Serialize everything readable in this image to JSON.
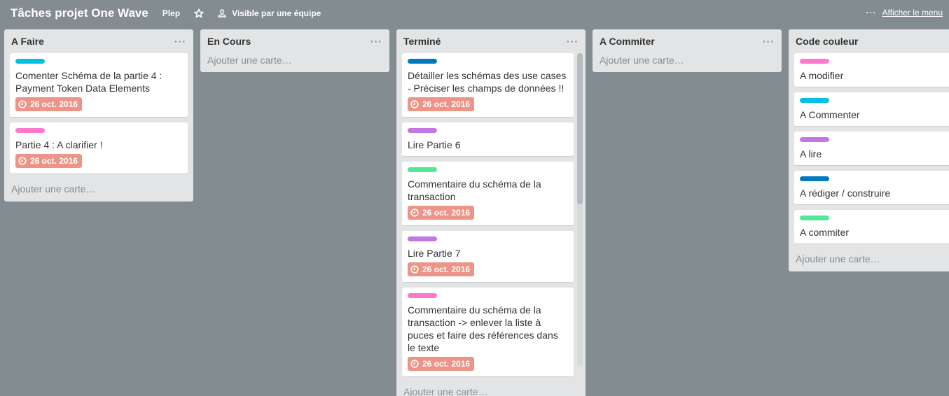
{
  "board": {
    "title": "Tâches projet One Wave",
    "org": "Plep",
    "visibility": "Visible par une équipe",
    "menu_label": "Afficher le menu"
  },
  "colors": {
    "cyan": "#00c2e0",
    "pink": "#ff78cb",
    "blue": "#0079bf",
    "purple": "#c377e0",
    "green": "#51e898",
    "due": "#ec9488"
  },
  "lists": {
    "afaire": {
      "title": "A Faire",
      "cards": [
        {
          "text": "Comenter Schéma de la partie 4 : Payment Token Data Elements",
          "label": "cyan",
          "due": "26 oct. 2016"
        },
        {
          "text": "Partie 4 : A clarifier !",
          "label": "pink",
          "due": "26 oct. 2016"
        }
      ],
      "add": "Ajouter une carte…"
    },
    "encours": {
      "title": "En Cours",
      "add": "Ajouter une carte…"
    },
    "termine": {
      "title": "Terminé",
      "cards": [
        {
          "text": "Détailler les schémas des use cases - Préciser les champs de données !!",
          "label": "blue",
          "due": "26 oct. 2016"
        },
        {
          "text": "Lire Partie 6",
          "label": "purple"
        },
        {
          "text": "Commentaire du schéma de la transaction",
          "label": "green",
          "due": "26 oct. 2016"
        },
        {
          "text": "Lire Partie 7",
          "label": "purple",
          "due": "26 oct. 2016"
        },
        {
          "text": "Commentaire du schéma de la transaction -> enlever la liste à puces et faire des références dans le texte",
          "label": "pink",
          "due": "26 oct. 2016"
        }
      ],
      "add": "Ajouter une carte…"
    },
    "acommiter": {
      "title": "A Commiter",
      "add": "Ajouter une carte…"
    },
    "codecouleur": {
      "title": "Code couleur",
      "cards": [
        {
          "text": "A modifier",
          "label": "pink"
        },
        {
          "text": "A Commenter",
          "label": "cyan"
        },
        {
          "text": "A lire",
          "label": "purple"
        },
        {
          "text": "A rédiger / construire",
          "label": "blue"
        },
        {
          "text": "A commiter",
          "label": "green"
        }
      ],
      "add": "Ajouter une carte…"
    }
  }
}
